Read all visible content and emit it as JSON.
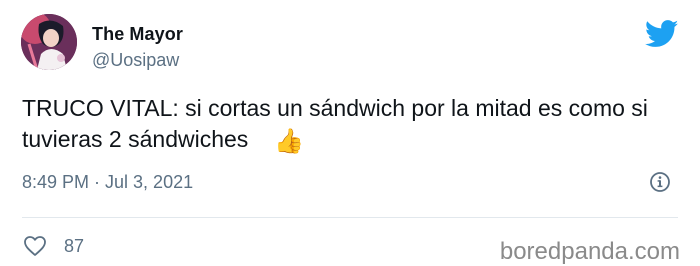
{
  "tweet": {
    "author_name": "The Mayor",
    "author_handle": "@Uosipaw",
    "text": "TRUCO VITAL: si cortas un sándwich por la mitad es como si tuvieras 2 sándwiches",
    "emoji": "👍",
    "timestamp": "8:49 PM · Jul 3, 2021",
    "like_count": "87"
  },
  "icons": {
    "brand": "twitter-bird-icon",
    "info": "info-icon",
    "like": "heart-icon"
  },
  "colors": {
    "twitter_blue": "#1da1f2",
    "muted_text": "#5b7083",
    "avatar_bg": "#6a2f5b"
  },
  "watermark": "boredpanda.com"
}
